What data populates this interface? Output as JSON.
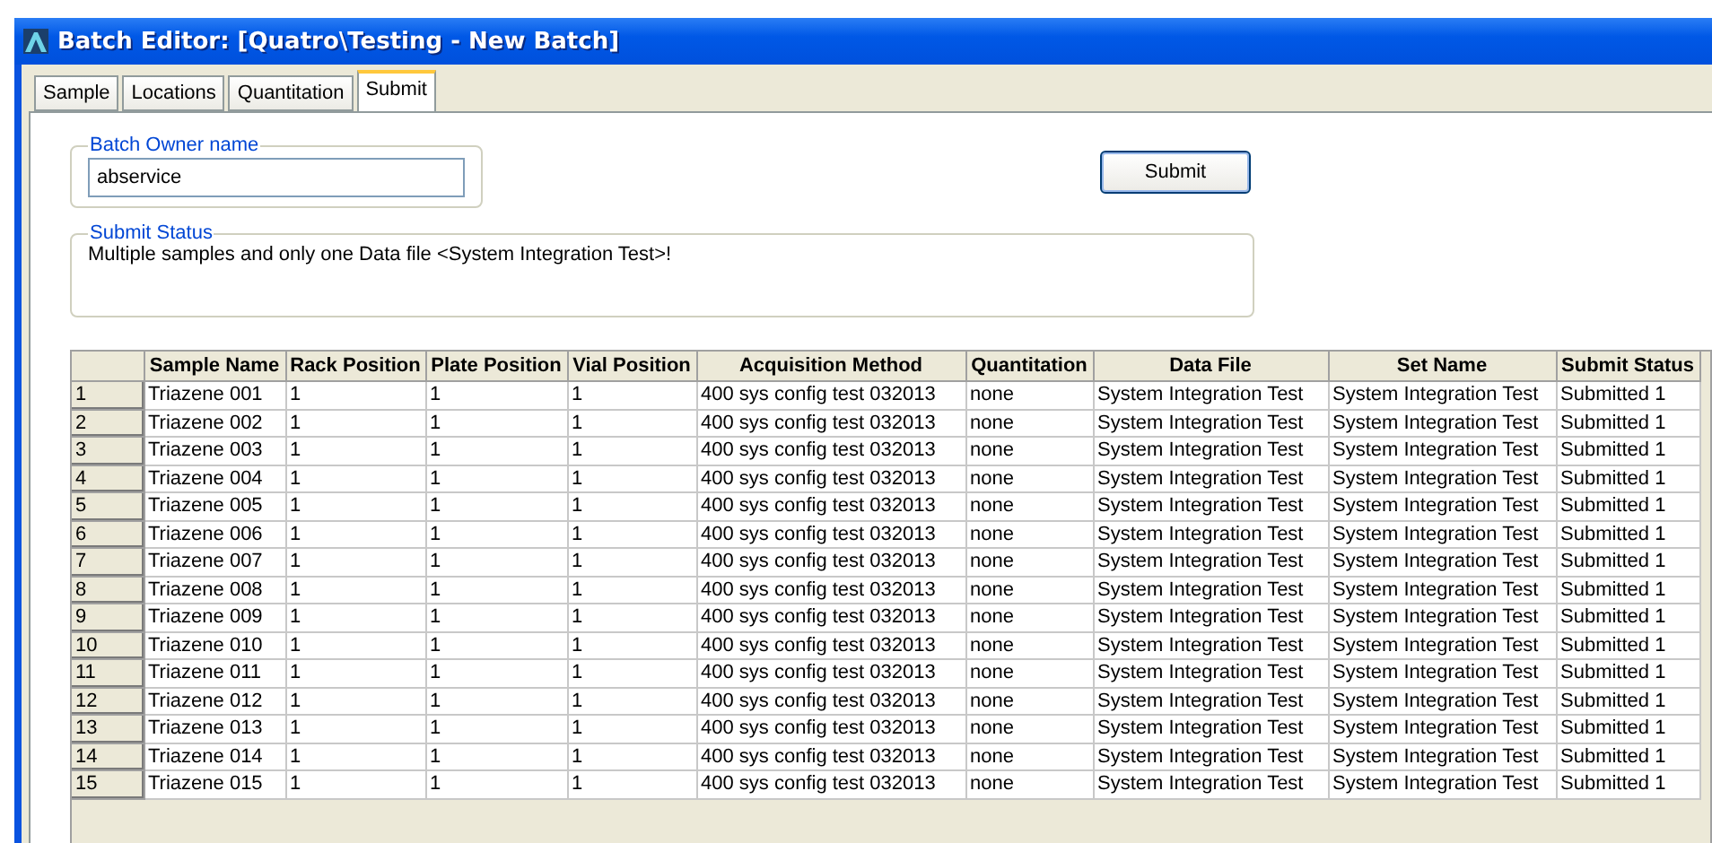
{
  "window": {
    "title": "Batch Editor: [Quatro\\Testing - New Batch]"
  },
  "tabs": [
    {
      "label": "Sample",
      "selected": false
    },
    {
      "label": "Locations",
      "selected": false
    },
    {
      "label": "Quantitation",
      "selected": false
    },
    {
      "label": "Submit",
      "selected": true
    }
  ],
  "owner_group": {
    "legend": "Batch Owner name",
    "value": "abservice"
  },
  "submit_button": {
    "label": "Submit"
  },
  "status_group": {
    "legend": "Submit Status",
    "message": "Multiple samples and only one Data file <System Integration Test>!"
  },
  "table": {
    "columns": [
      "Sample Name",
      "Rack Position",
      "Plate Position",
      "Vial Position",
      "Acquisition Method",
      "Quantitation",
      "Data File",
      "Set Name",
      "Submit Status"
    ],
    "rows": [
      {
        "number": "1",
        "cells": [
          "Triazene 001",
          "1",
          "1",
          "1",
          "400 sys config test 032013",
          "none",
          "System Integration Test",
          "System Integration Test",
          "Submitted 1"
        ]
      },
      {
        "number": "2",
        "cells": [
          "Triazene 002",
          "1",
          "1",
          "1",
          "400 sys config test 032013",
          "none",
          "System Integration Test",
          "System Integration Test",
          "Submitted 1"
        ]
      },
      {
        "number": "3",
        "cells": [
          "Triazene 003",
          "1",
          "1",
          "1",
          "400 sys config test 032013",
          "none",
          "System Integration Test",
          "System Integration Test",
          "Submitted 1"
        ]
      },
      {
        "number": "4",
        "cells": [
          "Triazene 004",
          "1",
          "1",
          "1",
          "400 sys config test 032013",
          "none",
          "System Integration Test",
          "System Integration Test",
          "Submitted 1"
        ]
      },
      {
        "number": "5",
        "cells": [
          "Triazene 005",
          "1",
          "1",
          "1",
          "400 sys config test 032013",
          "none",
          "System Integration Test",
          "System Integration Test",
          "Submitted 1"
        ]
      },
      {
        "number": "6",
        "cells": [
          "Triazene 006",
          "1",
          "1",
          "1",
          "400 sys config test 032013",
          "none",
          "System Integration Test",
          "System Integration Test",
          "Submitted 1"
        ]
      },
      {
        "number": "7",
        "cells": [
          "Triazene 007",
          "1",
          "1",
          "1",
          "400 sys config test 032013",
          "none",
          "System Integration Test",
          "System Integration Test",
          "Submitted 1"
        ]
      },
      {
        "number": "8",
        "cells": [
          "Triazene 008",
          "1",
          "1",
          "1",
          "400 sys config test 032013",
          "none",
          "System Integration Test",
          "System Integration Test",
          "Submitted 1"
        ]
      },
      {
        "number": "9",
        "cells": [
          "Triazene 009",
          "1",
          "1",
          "1",
          "400 sys config test 032013",
          "none",
          "System Integration Test",
          "System Integration Test",
          "Submitted 1"
        ]
      },
      {
        "number": "10",
        "cells": [
          "Triazene 010",
          "1",
          "1",
          "1",
          "400 sys config test 032013",
          "none",
          "System Integration Test",
          "System Integration Test",
          "Submitted 1"
        ]
      },
      {
        "number": "11",
        "cells": [
          "Triazene 011",
          "1",
          "1",
          "1",
          "400 sys config test 032013",
          "none",
          "System Integration Test",
          "System Integration Test",
          "Submitted 1"
        ]
      },
      {
        "number": "12",
        "cells": [
          "Triazene 012",
          "1",
          "1",
          "1",
          "400 sys config test 032013",
          "none",
          "System Integration Test",
          "System Integration Test",
          "Submitted 1"
        ]
      },
      {
        "number": "13",
        "cells": [
          "Triazene 013",
          "1",
          "1",
          "1",
          "400 sys config test 032013",
          "none",
          "System Integration Test",
          "System Integration Test",
          "Submitted 1"
        ]
      },
      {
        "number": "14",
        "cells": [
          "Triazene 014",
          "1",
          "1",
          "1",
          "400 sys config test 032013",
          "none",
          "System Integration Test",
          "System Integration Test",
          "Submitted 1"
        ]
      },
      {
        "number": "15",
        "cells": [
          "Triazene 015",
          "1",
          "1",
          "1",
          "400 sys config test 032013",
          "none",
          "System Integration Test",
          "System Integration Test",
          "Submitted 1"
        ]
      }
    ]
  }
}
